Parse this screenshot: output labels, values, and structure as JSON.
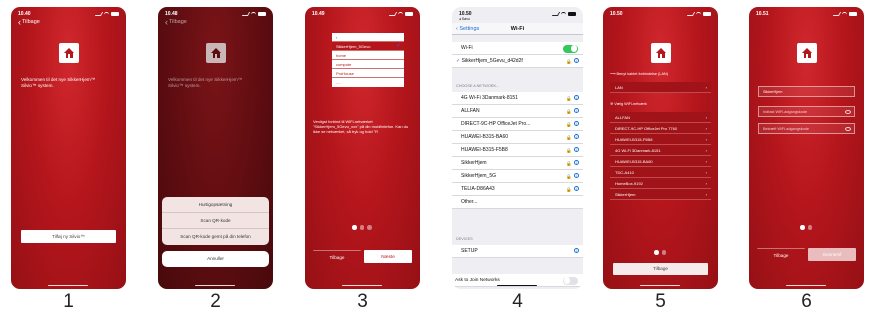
{
  "screens": [
    {
      "number": "1",
      "time": "10.40",
      "back": "Tilbage",
      "welcome": "Velkommen til det nye SikkerHjem™ Silvio™ system.",
      "button": "Tilføj ny Silvio™"
    },
    {
      "number": "2",
      "time": "10.48",
      "back": "Tilbage",
      "welcome": "Velkommen til det nye SikkerHjem™ Silvio™ system.",
      "sheet": [
        "Hurtigopsætning",
        "Scan QR-kode",
        "Scan QR-kode gemt på din telefon"
      ],
      "cancel": "Annuller"
    },
    {
      "number": "3",
      "time": "10.49",
      "dropdown": [
        "SikkerHjem_5Gevu",
        "home",
        "compote",
        "ProHouse",
        "....."
      ],
      "text": "Venligst forbind til WiFi-netværket \"SikkerHjem_5Gevu_xxx\" på din mobiltelefon. Kan du ikke se netværket, så tryk og hold \"R",
      "back_button": "Tilbage",
      "next_button": "Næste"
    },
    {
      "number": "4",
      "time": "10.50",
      "sub": "◂ Søvo",
      "nav_back": "Settings",
      "title": "Wi-Fi",
      "wifi_label": "Wi-Fi",
      "connected": "SikkerHjem_5Gevu_d42d2f",
      "choose_header": "CHOOSE A NETWORK...",
      "networks": [
        "4G Wi-Fi 3Danmark-8151",
        "ALLFAN",
        "DIRECT-9C-HP OfficeJet Pro...",
        "HUAWEI-B315-BA60",
        "HUAWEI-B315-F5B8",
        "SikkerHjem",
        "SikkerHjem_5G",
        "TELIA-D86A43",
        "Other..."
      ],
      "devices_header": "DEVICES",
      "device": "SETUP",
      "ask_join": "Ask to Join Networks"
    },
    {
      "number": "5",
      "time": "10.50",
      "wired_header": "Benyt kablet forbindelse (LAN)",
      "lan": "LAN",
      "wifi_header": "Vælg WiFi-netværk",
      "networks": [
        "ALLFAN",
        "DIRECT-9C-HP OfficeJet Pro 7760",
        "HUAWEI-B315-F5B8",
        "4G Wi-Fi 3Danmark-8151",
        "HUAWEI-B315-BA60",
        "TDC-A410",
        "HomeBox-9192",
        "SikkerHjem"
      ],
      "back_button": "Tilbage"
    },
    {
      "number": "6",
      "time": "10.51",
      "field_name": "SikkerHjem",
      "field_pw": "Indtast WiFi-adgangskode",
      "field_pw2": "Bekræft WiFi-adgangskode",
      "back_button": "Tilbage",
      "next_button": "Gennemf"
    }
  ]
}
